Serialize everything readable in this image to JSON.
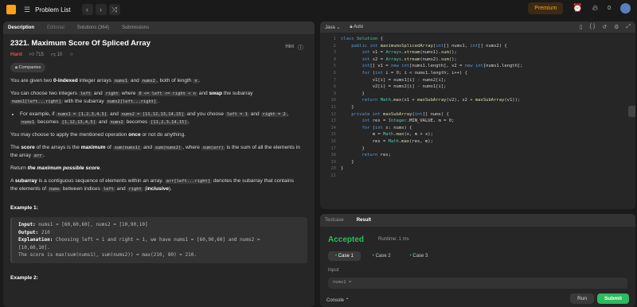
{
  "topbar": {
    "title": "Problem List",
    "premium": "Premium",
    "streak": "0"
  },
  "left_tabs": [
    "Description",
    "Editorial",
    "Solutions (364)",
    "Submissions"
  ],
  "problem": {
    "title": "2321. Maximum Score Of Spliced Array",
    "difficulty": "Hard",
    "likes": "715",
    "dislikes": "10",
    "hint": "Hint",
    "companies": "Companies"
  },
  "desc": {
    "p1a": "You are given two ",
    "p1b": "0-indexed",
    "p1c": " integer arrays ",
    "p1d": "nums1",
    "p1e": " and ",
    "p1f": "nums2",
    "p1g": ", both of length ",
    "p1h": "n",
    "p1i": ".",
    "p2a": "You can choose two integers ",
    "p2b": "left",
    "p2c": " and ",
    "p2d": "right",
    "p2e": " where ",
    "p2f": "0 <= left <= right < n",
    "p2g": " and ",
    "p2h": "swap",
    "p2i": " the subarray",
    "p2j": "nums1[left...right]",
    "p2k": " with the subarray ",
    "p2l": "nums2[left...right]",
    "p2m": ".",
    "b1a": "For example, if ",
    "b1b": "nums1 = [1,2,3,4,5]",
    "b1c": " and ",
    "b1d": "nums2 = [11,12,13,14,15]",
    "b1e": " and you choose ",
    "b1f": "left = 1",
    "b1g": " and ",
    "b1h": "right = 2",
    "b1i": ",",
    "b1j": "nums1",
    "b1k": " becomes ",
    "b1l": "[1,12,13,4,5]",
    "b1m": " and ",
    "b1n": "nums2",
    "b1o": " becomes ",
    "b1p": "[11,2,3,14,15]",
    "b1q": ".",
    "p3a": "You may choose to apply the mentioned operation ",
    "p3b": "once",
    "p3c": " or not do anything.",
    "p4a": "The ",
    "p4b": "score",
    "p4c": " of the arrays is the ",
    "p4d": "maximum",
    "p4e": " of ",
    "p4f": "sum(nums1)",
    "p4g": " and ",
    "p4h": "sum(nums2)",
    "p4i": ", where ",
    "p4j": "sum(arr)",
    "p4k": " is the sum of all the elements in",
    "p4l": "the array ",
    "p4m": "arr",
    "p4n": ".",
    "p5a": "Return ",
    "p5b": "the maximum possible score",
    "p5c": ".",
    "p6a": "A ",
    "p6b": "subarray",
    "p6c": " is a contiguous sequence of elements within an array. ",
    "p6d": "arr[left...right]",
    "p6e": " denotes the subarray that contains",
    "p6f": "the elements of ",
    "p6g": "nums",
    "p6h": " between indices ",
    "p6i": "left",
    "p6j": " and ",
    "p6k": "right",
    "p6l": " (",
    "p6m": "inclusive",
    "p6n": ")."
  },
  "example1": {
    "title": "Example 1:",
    "input_k": "Input:",
    "input_v": " nums1 = [60,60,60], nums2 = [10,90,10]",
    "output_k": "Output:",
    "output_v": " 210",
    "expl_k": "Explanation:",
    "expl_v": " Choosing left = 1 and right = 1, we have nums1 = [60,90,60] and nums2 =",
    "expl_v2": "[10,60,10].",
    "expl_v3": "The score is max(sum(nums1), sum(nums2)) = max(210, 80) = 210."
  },
  "example2": {
    "title": "Example 2:"
  },
  "editor": {
    "language": "Java",
    "mode": "Auto",
    "line_numbers": [
      "1",
      "2",
      "3",
      "4",
      "5",
      "6",
      "7",
      "8",
      "9",
      "10",
      "11",
      "12",
      "13",
      "14",
      "15",
      "16",
      "17",
      "18",
      "19",
      "20",
      "21"
    ],
    "code": [
      "class Solution {",
      "    public int maximumsSplicedArray(int[] nums1, int[] nums2) {",
      "        int s1 = Arrays.stream(nums1).sum();",
      "        int s2 = Arrays.stream(nums2).sum();",
      "        int[] v1 = new int[nums1.length], v2 = new int[nums1.length];",
      "        for (int i = 0; i < nums1.length; i++) {",
      "            v1[i] = nums1[i] - nums2[i];",
      "            v2[i] = nums2[i] - nums1[i];",
      "        }",
      "        return Math.max(s1 + maxSubArray(v2), s2 + maxSubArray(v1));",
      "    }",
      "    private int maxSubArray(int[] nums) {",
      "        int res = Integer.MIN_VALUE, m = 0;",
      "        for (int x: nums) {",
      "            m = Math.max(x, m + x);",
      "            res = Math.max(res, m);",
      "        }",
      "        return res;",
      "    }",
      "}",
      ""
    ]
  },
  "console": {
    "tabs": [
      "Testcase",
      "Result"
    ],
    "status": "Accepted",
    "runtime": "Runtime: 1 ms",
    "cases": [
      "Case 1",
      "Case 2",
      "Case 3"
    ],
    "input_label": "Input",
    "input_value": "nums1 =",
    "console_label": "Console",
    "run": "Run",
    "submit": "Submit"
  }
}
